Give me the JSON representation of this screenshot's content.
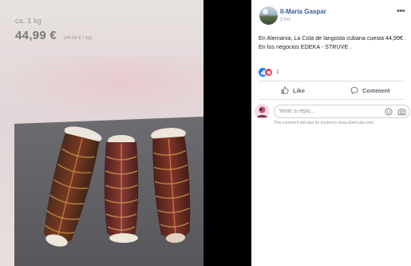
{
  "photo": {
    "size_text": "ca. 1 kg",
    "price": "44,99 €",
    "unit_price": "(44,99 € / kg)"
  },
  "post": {
    "author": "Il-Maria Gaspar",
    "time": "2 hrs",
    "more_label": "•••",
    "text": "En Alemania, La Cola de langosta cubana cuesta 44,99€ . En los negocios EDEKA - STRUVE .",
    "reaction_count": "1"
  },
  "actions": {
    "like_label": "Like",
    "comment_label": "Comment"
  },
  "composer": {
    "placeholder": "Write a reply...",
    "notice": "This comment will also be posted to www.cibercuba.com."
  },
  "colors": {
    "link_blue": "#385898",
    "like_blue": "#1877f2",
    "love_red": "#f33e58",
    "muted_text": "#606770"
  }
}
